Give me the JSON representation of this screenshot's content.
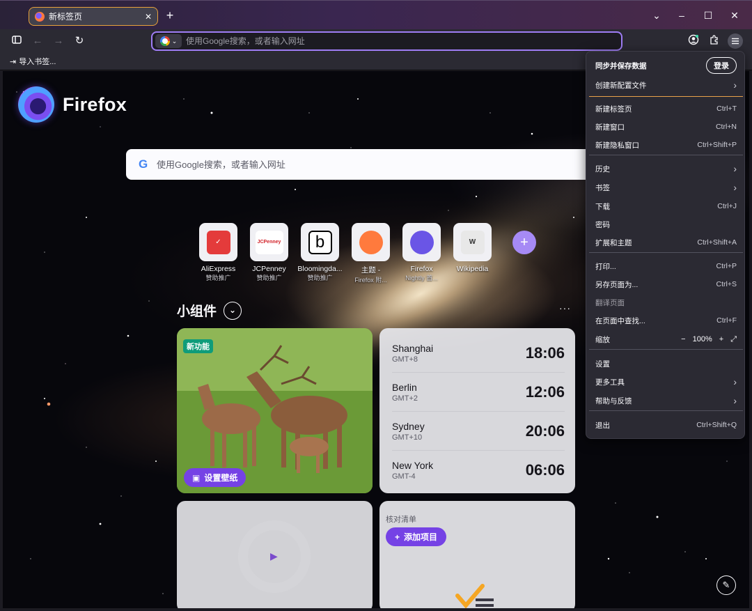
{
  "window": {
    "tab_title": "新标签页",
    "tab_close": "✕",
    "new_tab": "+",
    "controls": [
      "⌄",
      "–",
      "☐",
      "✕"
    ]
  },
  "navbar": {
    "back": "←",
    "forward": "→",
    "reload": "↻",
    "url_placeholder": "使用Google搜索，或者输入网址"
  },
  "bookmarks": {
    "import_label": "导入书签..."
  },
  "newtab": {
    "brand": "Firefox",
    "search_placeholder": "使用Google搜索，或者输入网址",
    "top_sites": [
      {
        "title": "AliExpress",
        "subtitle": "赞助推广",
        "glyph": "✓",
        "bg": "#e43b3b",
        "fg": "#ffffff"
      },
      {
        "title": "JCPenney",
        "subtitle": "赞助推广",
        "glyph": "JCPenney",
        "bg": "#ffffff",
        "fg": "#d2232a"
      },
      {
        "title": "Bloomingda...",
        "subtitle": "赞助推广",
        "glyph": "b",
        "bg": "#ffffff",
        "fg": "#000000"
      },
      {
        "title": "主题 -",
        "subtitle": "Firefox 附...",
        "glyph": "ff",
        "bg": "#ff7a3d",
        "fg": "#ffffff"
      },
      {
        "title": "Firefox",
        "subtitle": "Nightly 首...",
        "glyph": "ff",
        "bg": "#6a55e6",
        "fg": "#ffffff"
      },
      {
        "title": "Wikipedia",
        "subtitle": "",
        "glyph": "W",
        "bg": "#e8e8e8",
        "fg": "#333333"
      }
    ],
    "add_site": "+",
    "widgets_title": "小组件",
    "widgets_more": "···",
    "wallpaper": {
      "badge": "新功能",
      "button": "设置壁纸"
    },
    "clocks": [
      {
        "city": "Shanghai",
        "tz": "GMT+8",
        "time": "18:06"
      },
      {
        "city": "Berlin",
        "tz": "GMT+2",
        "time": "12:06"
      },
      {
        "city": "Sydney",
        "tz": "GMT+10",
        "time": "20:06"
      },
      {
        "city": "New York",
        "tz": "GMT-4",
        "time": "06:06"
      }
    ],
    "checklist": {
      "title": "核对清单",
      "add_button": "添加项目"
    }
  },
  "app_menu": {
    "sync_label": "同步并保存数据",
    "signin_button": "登录",
    "create_profile": "创建新配置文件",
    "items": [
      {
        "label": "新建标签页",
        "shortcut": "Ctrl+T"
      },
      {
        "label": "新建窗口",
        "shortcut": "Ctrl+N"
      },
      {
        "label": "新建隐私窗口",
        "shortcut": "Ctrl+Shift+P"
      },
      {
        "label": "历史",
        "shortcut": ""
      },
      {
        "label": "书签",
        "shortcut": ""
      },
      {
        "label": "下载",
        "shortcut": "Ctrl+J"
      },
      {
        "label": "密码",
        "shortcut": ""
      },
      {
        "label": "扩展和主题",
        "shortcut": "Ctrl+Shift+A"
      },
      {
        "label": "打印...",
        "shortcut": "Ctrl+P"
      },
      {
        "label": "另存页面为...",
        "shortcut": "Ctrl+S"
      },
      {
        "label": "翻译页面",
        "shortcut": ""
      },
      {
        "label": "在页面中查找...",
        "shortcut": "Ctrl+F"
      },
      {
        "label": "缩放",
        "shortcut": ""
      },
      {
        "label": "设置",
        "shortcut": ""
      },
      {
        "label": "更多工具",
        "shortcut": ""
      },
      {
        "label": "帮助与反馈",
        "shortcut": ""
      },
      {
        "label": "退出",
        "shortcut": "Ctrl+Shift+Q"
      }
    ],
    "zoom": {
      "minus": "−",
      "value": "100%",
      "plus": "+",
      "fullscreen": "⤢"
    }
  }
}
